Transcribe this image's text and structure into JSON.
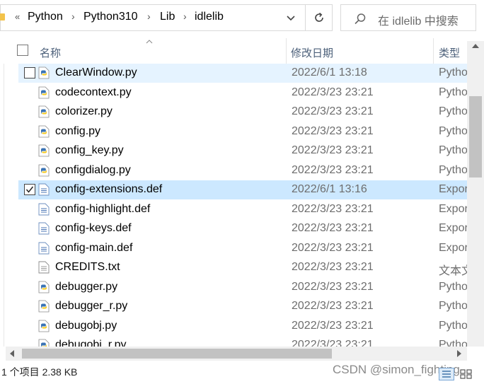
{
  "address_bar": {
    "overflow": "«",
    "breadcrumbs": [
      "Python",
      "Python310",
      "Lib",
      "idlelib"
    ],
    "separator": "›"
  },
  "search": {
    "placeholder": "在 idlelib 中搜索"
  },
  "columns": {
    "name": "名称",
    "date_modified": "修改日期",
    "type": "类型"
  },
  "files": [
    {
      "name": "ClearWindow.py",
      "date": "2022/6/1 13:18",
      "type": "Pytho",
      "icon": "python-file-icon",
      "state": "selected-unchecked"
    },
    {
      "name": "codecontext.py",
      "date": "2022/3/23 23:21",
      "type": "Pytho",
      "icon": "python-file-icon",
      "state": ""
    },
    {
      "name": "colorizer.py",
      "date": "2022/3/23 23:21",
      "type": "Pytho",
      "icon": "python-file-icon",
      "state": ""
    },
    {
      "name": "config.py",
      "date": "2022/3/23 23:21",
      "type": "Pytho",
      "icon": "python-file-icon",
      "state": ""
    },
    {
      "name": "config_key.py",
      "date": "2022/3/23 23:21",
      "type": "Pytho",
      "icon": "python-file-icon",
      "state": ""
    },
    {
      "name": "configdialog.py",
      "date": "2022/3/23 23:21",
      "type": "Pytho",
      "icon": "python-file-icon",
      "state": ""
    },
    {
      "name": "config-extensions.def",
      "date": "2022/6/1 13:16",
      "type": "Expor",
      "icon": "def-file-icon",
      "state": "hovered-checked"
    },
    {
      "name": "config-highlight.def",
      "date": "2022/3/23 23:21",
      "type": "Expor",
      "icon": "def-file-icon",
      "state": ""
    },
    {
      "name": "config-keys.def",
      "date": "2022/3/23 23:21",
      "type": "Expor",
      "icon": "def-file-icon",
      "state": ""
    },
    {
      "name": "config-main.def",
      "date": "2022/3/23 23:21",
      "type": "Expor",
      "icon": "def-file-icon",
      "state": ""
    },
    {
      "name": "CREDITS.txt",
      "date": "2022/3/23 23:21",
      "type": "文本文",
      "icon": "text-file-icon",
      "state": ""
    },
    {
      "name": "debugger.py",
      "date": "2022/3/23 23:21",
      "type": "Pytho",
      "icon": "python-file-icon",
      "state": ""
    },
    {
      "name": "debugger_r.py",
      "date": "2022/3/23 23:21",
      "type": "Pytho",
      "icon": "python-file-icon",
      "state": ""
    },
    {
      "name": "debugobj.py",
      "date": "2022/3/23 23:21",
      "type": "Pytho",
      "icon": "python-file-icon",
      "state": ""
    },
    {
      "name": "debugobj_r.py",
      "date": "2022/3/23 23:21",
      "type": "Pytho",
      "icon": "python-file-icon",
      "state": ""
    }
  ],
  "status_bar": {
    "selection": "1 个项目  2.38 KB"
  },
  "watermark": "CSDN @simon_fighting",
  "colors": {
    "selected_row": "#e5f3ff",
    "hovered_row": "#cce8ff",
    "header_text": "#4c607a",
    "python_blue": "#3a73b4",
    "python_yellow": "#f6c91c"
  }
}
